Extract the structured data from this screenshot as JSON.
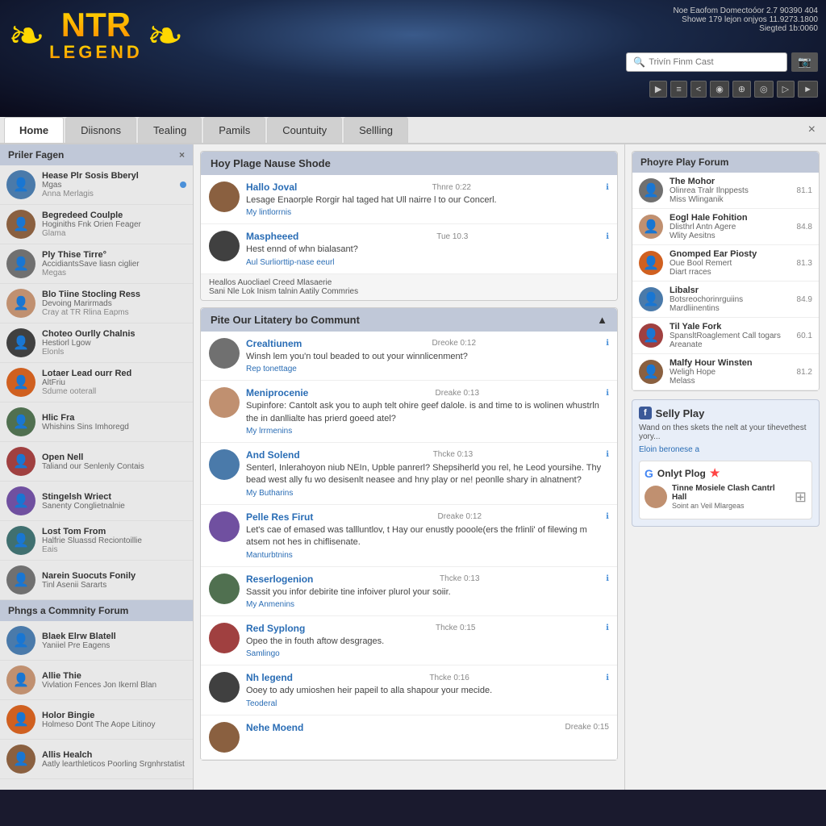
{
  "header": {
    "top_right_line1": "Noe Eaofom Domectoóor 2.7 90390 404",
    "top_right_line2": "Showe 179 lejon onjyos 11.9273.1800",
    "top_right_line3": "Siegted 1b:0060",
    "logo_top": "NTR",
    "logo_bottom": "LEGEND",
    "search_placeholder": "Trivín Finm Cast",
    "icon_labels": [
      "▶",
      "≡",
      "<",
      "◉",
      "⊕",
      "⊙",
      "▷",
      "►"
    ]
  },
  "nav": {
    "tabs": [
      "Home",
      "Diisnons",
      "Tealing",
      "Pamils",
      "Countuity",
      "Sellling"
    ],
    "active_tab": 0,
    "close_label": "×"
  },
  "left_sidebar": {
    "section1_title": "Priler Fagen",
    "close": "×",
    "users": [
      {
        "name": "Hease Plr Sosis Bberyl",
        "sub1": "Mgas",
        "sub2": "Anna Merlagis",
        "online": true
      },
      {
        "name": "Begredeed Coulple",
        "sub1": "Hoginiths Fnk Orien Feager",
        "sub2": "Glama",
        "online": false
      },
      {
        "name": "Ply Thise Tirre°",
        "sub1": "AccidiantsSave liasn ciglier",
        "sub2": "Megas",
        "online": false
      },
      {
        "name": "Blo Tiine Stocling Ress",
        "sub1": "Devoing Marirmads",
        "sub2": "Cray at TR Rlina Eapms",
        "online": false
      },
      {
        "name": "Choteo Ourlly Chalnis",
        "sub1": "Hestiorl Lgow",
        "sub2": "Elonls",
        "online": false
      },
      {
        "name": "Lotaer Lead ourr Red",
        "sub1": "AltFriu",
        "sub2": "Sdume ooterall",
        "online": false
      },
      {
        "name": "Hlic Fra",
        "sub1": "Whishins Sins Imhoregd",
        "sub2": "",
        "online": false
      },
      {
        "name": "Open Nell",
        "sub1": "Taliand our Senlenly Contais",
        "sub2": "",
        "online": false
      },
      {
        "name": "Stingelsh Wriect",
        "sub1": "Sanenty Conglietnalnie",
        "sub2": "",
        "online": false
      },
      {
        "name": "Lost Tom From",
        "sub1": "Halfrie Sluassd Reciontoillie",
        "sub2": "Eais",
        "online": false
      },
      {
        "name": "Narein Suocuts Fonily",
        "sub1": "Tinl Asenii Sararts",
        "sub2": "",
        "online": false
      }
    ],
    "section2_title": "Phngs a Commnity Forum",
    "forum_users": [
      {
        "name": "Blaek Elrw Blatell",
        "sub1": "Yaniiel Pre Eagens"
      },
      {
        "name": "Allie Thie",
        "sub1": "Vivlation Fences Jon Ikernl Blan"
      },
      {
        "name": "Holor Bingie",
        "sub1": "Holmeso Dont The Aope Litinoy"
      },
      {
        "name": "Allis Healch",
        "sub1": "Aatly learthleticos Poorling Srgnhrstatist"
      }
    ]
  },
  "center": {
    "panel1_title": "Hoy Plage Nause Shode",
    "posts1": [
      {
        "author": "Hallo Joval",
        "time": "Thnre 0:22",
        "text": "Lesage Enaorple Rorgir hal taged hat Ull nairre l to our Concerl.",
        "link": "My lintlorrnis"
      },
      {
        "author": "Maspheeed",
        "time": "Tue 10.3",
        "text": "Hest ennd of whn bialasant?",
        "link": "Aul Surliorttip-nase eeurl"
      }
    ],
    "panel1_footer1": "Heallos Auocliael Creed Mlasaerie",
    "panel1_footer2": "Sani Nle Lok Inism talnin Aatily Commries",
    "panel2_title": "Pite Our Litatery bo Communt",
    "posts2": [
      {
        "author": "Crealtiunem",
        "time": "Dreoke 0:12",
        "text": "Winsh lem you'n toul beaded to out your winnlicenment?",
        "link": "Rep tonettage"
      },
      {
        "author": "Meniprocenie",
        "time": "Dreake 0:13",
        "text": "Supinfore: Cantolt ask you to auph telt ohire geef dalole. is and time to is wolinen whustrln the in danllialte has prierd goeed atel?",
        "link": "My lrrmenins"
      },
      {
        "author": "And Solend",
        "time": "Thcke 0:13",
        "text": "Senterl, Inlerahoyon niub NEIn, Upble panrerl? Shepsiherld you rel, he Leod yoursihe. Thy bead west ally fu wo desisenlt neasee and hny play or ne! peonlle shary in alnatnent?",
        "link": "My Butharins"
      },
      {
        "author": "Pelle Res Firut",
        "time": "Dreake 0:12",
        "text": "Let's cae of emased was tallluntlov, t Hay our enustly pooole(ers the frlinli' of filewing m atsem not hes in chiflisenate.",
        "link": "Manturbtnins"
      },
      {
        "author": "Reserlogenion",
        "time": "Thcke 0:13",
        "text": "Sassit you infor debirite tine infoiver plurol your soiir.",
        "link": "My Anmenins"
      },
      {
        "author": "Red Syplong",
        "time": "Thcke 0:15",
        "text": "Opeo the in fouth aftow desgrages.",
        "link": "Samlingo"
      },
      {
        "author": "Nh legend",
        "time": "Thcke 0:16",
        "text": "Ooey to ady umioshen heir papeil to alla shapour your mecide.",
        "link": "Teoderal"
      },
      {
        "author": "Nehe Moend",
        "time": "Dreake 0:15",
        "text": "",
        "link": ""
      }
    ]
  },
  "right_sidebar": {
    "panel1_title": "Phoyre Play Forum",
    "forum_users": [
      {
        "name": "The Mohor",
        "sub1": "Olinrea Tralr Ilnppests",
        "sub2": "Miss Wlinganik",
        "count": "81.1"
      },
      {
        "name": "Eogl Hale Fohition",
        "sub1": "Dlisthrl Antn Agere",
        "sub2": "Wlity Aesitns",
        "count": "84.8"
      },
      {
        "name": "Gnomped Ear Piosty",
        "sub1": "Oue Bool Remert",
        "sub2": "Diart rraces",
        "count": "81.3"
      },
      {
        "name": "Libalsr",
        "sub1": "Botsreochorinrguiins",
        "sub2": "Mardliinentins",
        "count": "84.9"
      },
      {
        "name": "Til Yale Fork",
        "sub1": "SpansltRoaglement Call togars",
        "sub2": "Areanate",
        "count": "60.1"
      },
      {
        "name": "Malfy Hour Winsten",
        "sub1": "Weligh Hope",
        "sub2": "Melass",
        "count": "81.2"
      }
    ],
    "social_title": "Selly Play",
    "social_text": "Wand on thes skets the nelt at your tihevethest yory...",
    "social_link": "Eloin beronese a",
    "google_title": "Onlyt Plog",
    "mini_post": {
      "title": "Tinne Mosiele Clash Cantrl Hall",
      "sub": "Soint an Veil Mlargeas"
    }
  }
}
